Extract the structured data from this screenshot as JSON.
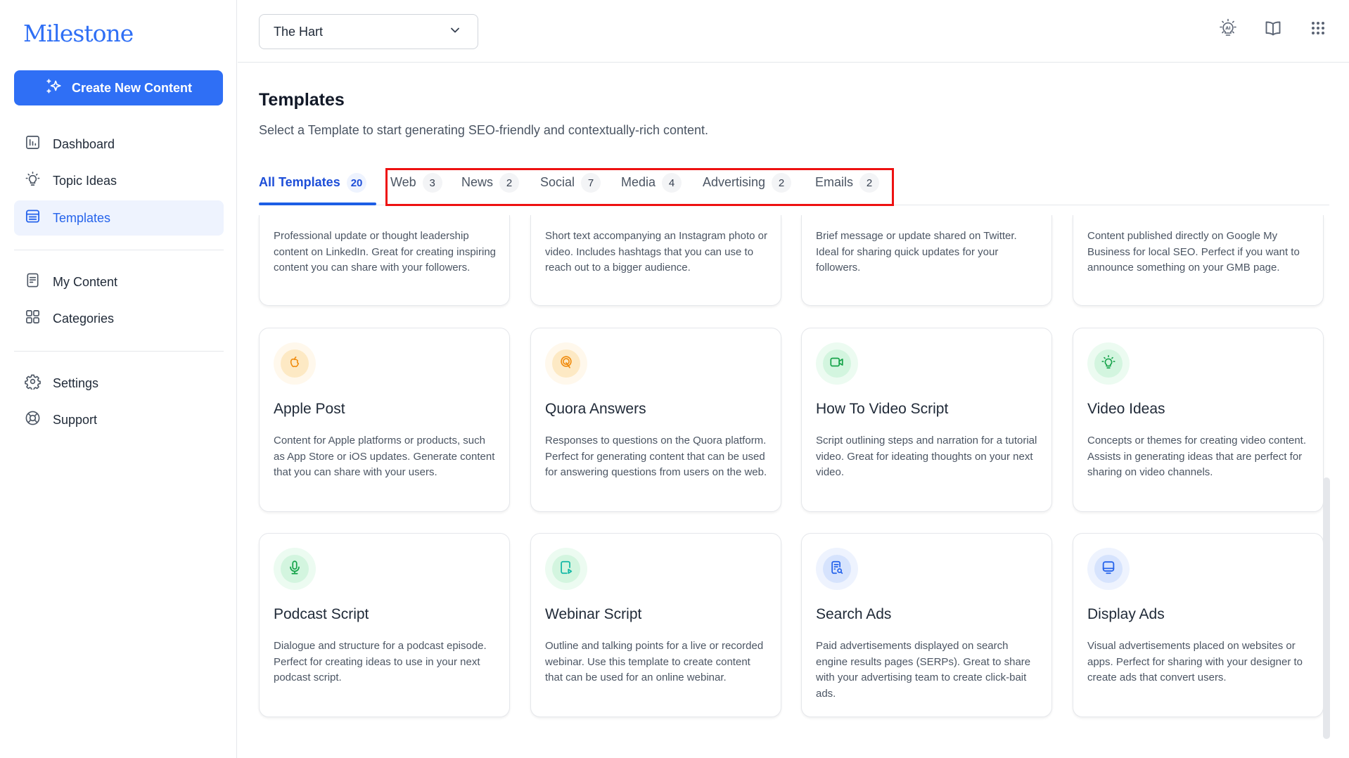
{
  "brand": {
    "logo_text": "Milestone",
    "accent": "#2f6ff5"
  },
  "sidebar": {
    "create_button": "Create New Content",
    "items": [
      {
        "label": "Dashboard",
        "icon": "chart-icon",
        "active": false
      },
      {
        "label": "Topic Ideas",
        "icon": "lightbulb-icon",
        "active": false
      },
      {
        "label": "Templates",
        "icon": "template-icon",
        "active": true
      },
      {
        "label": "My Content",
        "icon": "document-icon",
        "active": false
      },
      {
        "label": "Categories",
        "icon": "grid-icon",
        "active": false
      },
      {
        "label": "Settings",
        "icon": "gear-icon",
        "active": false
      },
      {
        "label": "Support",
        "icon": "lifebuoy-icon",
        "active": false
      }
    ]
  },
  "header": {
    "site_selector": "The Hart",
    "icons": [
      "ai-lightbulb-icon",
      "book-icon",
      "apps-grid-icon"
    ]
  },
  "main": {
    "title": "Templates",
    "subtitle": "Select a Template to start generating SEO-friendly and contextually-rich content.",
    "tabs": [
      {
        "label": "All Templates",
        "count": "20",
        "active": true
      },
      {
        "label": "Web",
        "count": "3"
      },
      {
        "label": "News",
        "count": "2"
      },
      {
        "label": "Social",
        "count": "7"
      },
      {
        "label": "Media",
        "count": "4"
      },
      {
        "label": "Advertising",
        "count": "2"
      },
      {
        "label": "Emails",
        "count": "2"
      }
    ],
    "cards": [
      {
        "title": "",
        "desc": "Professional update or thought leadership content on LinkedIn. Great for creating inspiring content you can share with your followers."
      },
      {
        "title": "",
        "desc": "Short text accompanying an Instagram photo or video. Includes hashtags that you can use to reach out to a bigger audience."
      },
      {
        "title": "",
        "desc": "Brief message or update shared on Twitter. Ideal for sharing quick updates for your followers."
      },
      {
        "title": "",
        "desc": "Content published directly on Google My Business for local SEO. Perfect if you want to announce something on your GMB page."
      },
      {
        "title": "Apple Post",
        "icon": "apple-icon",
        "color": "#f08a0b",
        "desc": "Content for Apple platforms or products, such as App Store or iOS updates. Generate content that you can share with your users."
      },
      {
        "title": "Quora Answers",
        "icon": "quora-icon",
        "color": "#f08a0b",
        "desc": "Responses to questions on the Quora platform. Perfect for generating content that can be used for answering questions from users on the web."
      },
      {
        "title": "How To Video Script",
        "icon": "video-camera-icon",
        "color": "#16a34a",
        "desc": "Script outlining steps and narration for a tutorial video. Great for ideating thoughts on your next video."
      },
      {
        "title": "Video Ideas",
        "icon": "lightbulb-icon",
        "color": "#16a34a",
        "desc": "Concepts or themes for creating video content. Assists in generating ideas that are perfect for sharing on video channels."
      },
      {
        "title": "Podcast Script",
        "icon": "microphone-icon",
        "color": "#16a34a",
        "desc": "Dialogue and structure for a podcast episode. Perfect for creating ideas to use in your next podcast script."
      },
      {
        "title": "Webinar Script",
        "icon": "webinar-play-icon",
        "color": "#14b8a6",
        "desc": "Outline and talking points for a live or recorded webinar. Use this template to create content that can be used for an online webinar."
      },
      {
        "title": "Search Ads",
        "icon": "search-document-icon",
        "color": "#2563eb",
        "desc": "Paid advertisements displayed on search engine results pages (SERPs). Great to share with your advertising team to create click-bait ads."
      },
      {
        "title": "Display Ads",
        "icon": "monitor-icon",
        "color": "#2563eb",
        "desc": "Visual advertisements placed on websites or apps. Perfect for sharing with your designer to create ads that convert users."
      }
    ]
  }
}
